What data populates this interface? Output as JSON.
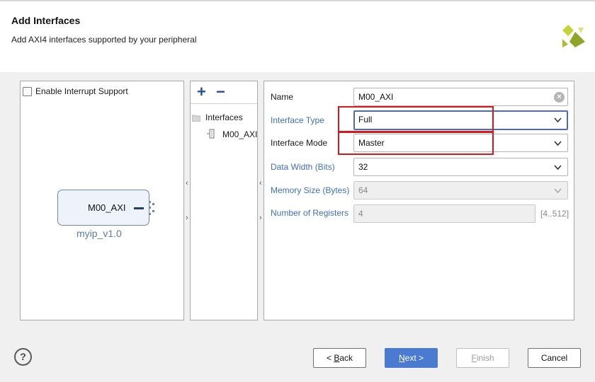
{
  "header": {
    "title": "Add Interfaces",
    "subtitle": "Add AXI4 interfaces supported by your peripheral"
  },
  "left_panel": {
    "interrupt_label": "Enable Interrupt Support",
    "interrupt_checked": false,
    "ip_port_label": "M00_AXI",
    "ip_name": "myip_v1.0"
  },
  "middle_panel": {
    "add_symbol": "+",
    "remove_symbol": "−",
    "tree_root": "Interfaces",
    "tree_child": "M00_AXI"
  },
  "form": {
    "name": {
      "label": "Name",
      "value": "M00_AXI"
    },
    "interface_type": {
      "label": "Interface Type",
      "value": "Full"
    },
    "interface_mode": {
      "label": "Interface Mode",
      "value": "Master"
    },
    "data_width": {
      "label": "Data Width (Bits)",
      "value": "32"
    },
    "memory_size": {
      "label": "Memory Size (Bytes)",
      "value": "64"
    },
    "num_registers": {
      "label": "Number of Registers",
      "value": "4",
      "range": "[4..512]"
    }
  },
  "footer": {
    "help": "?",
    "back_prefix": "< ",
    "back_key": "B",
    "back_rest": "ack",
    "next_key": "N",
    "next_rest": "ext >",
    "finish_key": "F",
    "finish_rest": "inish",
    "cancel": "Cancel"
  },
  "colors": {
    "accent": "#4a7bd0",
    "highlight": "#e0141b",
    "link_label": "#3f6fbf"
  }
}
